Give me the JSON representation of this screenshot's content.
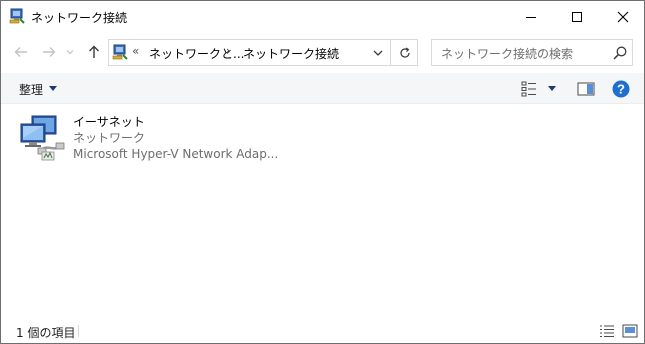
{
  "window": {
    "title": "ネットワーク接続",
    "icon": "network-connections-icon"
  },
  "nav": {
    "back_icon": "arrow-left-icon",
    "forward_icon": "arrow-right-icon",
    "recent_icon": "chevron-down-icon",
    "up_icon": "arrow-up-icon"
  },
  "address": {
    "overflow": "«",
    "segment1": "ネットワークと...",
    "separator": "›",
    "segment2": "ネットワーク接続"
  },
  "search": {
    "placeholder": "ネットワーク接続の検索"
  },
  "commandbar": {
    "organize_label": "整理"
  },
  "items": [
    {
      "name": "イーサネット",
      "type": "ネットワーク",
      "device": "Microsoft Hyper-V Network Adap...",
      "icon": "ethernet-adapter-icon"
    }
  ],
  "statusbar": {
    "count": "1 個の項目"
  },
  "colors": {
    "accent": "#1e6fd0",
    "help": "#1e6fd0"
  }
}
